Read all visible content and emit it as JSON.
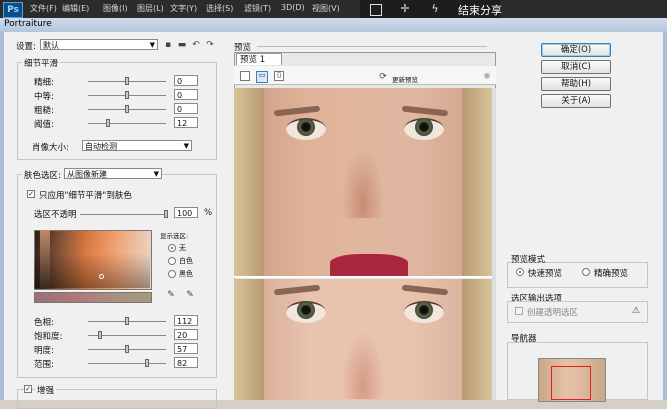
{
  "ps": {
    "logo": "Ps",
    "menu": [
      "文件(F)",
      "编辑(E)",
      "图像(I)",
      "图层(L)",
      "文字(Y)",
      "选择(S)",
      "滤镜(T)",
      "3D(D)",
      "视图(V)"
    ],
    "share": "结束分享",
    "icons": [
      "select-rect-icon",
      "crosshair-icon",
      "lightning-icon"
    ]
  },
  "window": {
    "title": "Portraiture"
  },
  "settings": {
    "label": "设置:",
    "value": "默认"
  },
  "detail": {
    "title": "细节平滑",
    "rows": [
      {
        "label": "精细:",
        "value": "0",
        "pos": 0.5
      },
      {
        "label": "中等:",
        "value": "0",
        "pos": 0.5
      },
      {
        "label": "粗糙:",
        "value": "0",
        "pos": 0.5
      },
      {
        "label": "阈值:",
        "value": "12",
        "pos": 0.25
      }
    ],
    "portrait_size_label": "肖像大小:",
    "portrait_size_value": "自动检测"
  },
  "mask": {
    "title": "肤色选区:",
    "select_value": "从图像新建",
    "apply_only_label": "只应用\"细节平滑\"到肤色",
    "opacity_label": "选区不透明",
    "opacity_value": "100",
    "opacity_unit": "%",
    "opacity_pos": 1.0,
    "display_label": "显示选区:",
    "display_options": [
      "无",
      "白色",
      "黑色"
    ],
    "display_selected": 0,
    "rows": [
      {
        "label": "色相:",
        "value": "112",
        "pos": 0.5
      },
      {
        "label": "饱和度:",
        "value": "20",
        "pos": 0.15
      },
      {
        "label": "明度:",
        "value": "57",
        "pos": 0.5
      },
      {
        "label": "范围:",
        "value": "82",
        "pos": 0.75
      }
    ]
  },
  "enhance": {
    "label": "增强",
    "checked": true
  },
  "preview": {
    "section_label": "预览",
    "tab": "预览 1",
    "update_label": "更新预览"
  },
  "buttons": {
    "ok": "确定(O)",
    "cancel": "取消(C)",
    "help": "帮助(H)",
    "about": "关于(A)"
  },
  "preview_mode": {
    "title": "预览模式",
    "options": [
      "快速预览",
      "精确预览"
    ],
    "selected": 0
  },
  "output": {
    "title": "选区输出选项",
    "create_label": "创建透明选区"
  },
  "navigator": {
    "title": "导航器"
  },
  "colors": {
    "accent": "#3c7fb1",
    "lips": "#a8273f"
  }
}
